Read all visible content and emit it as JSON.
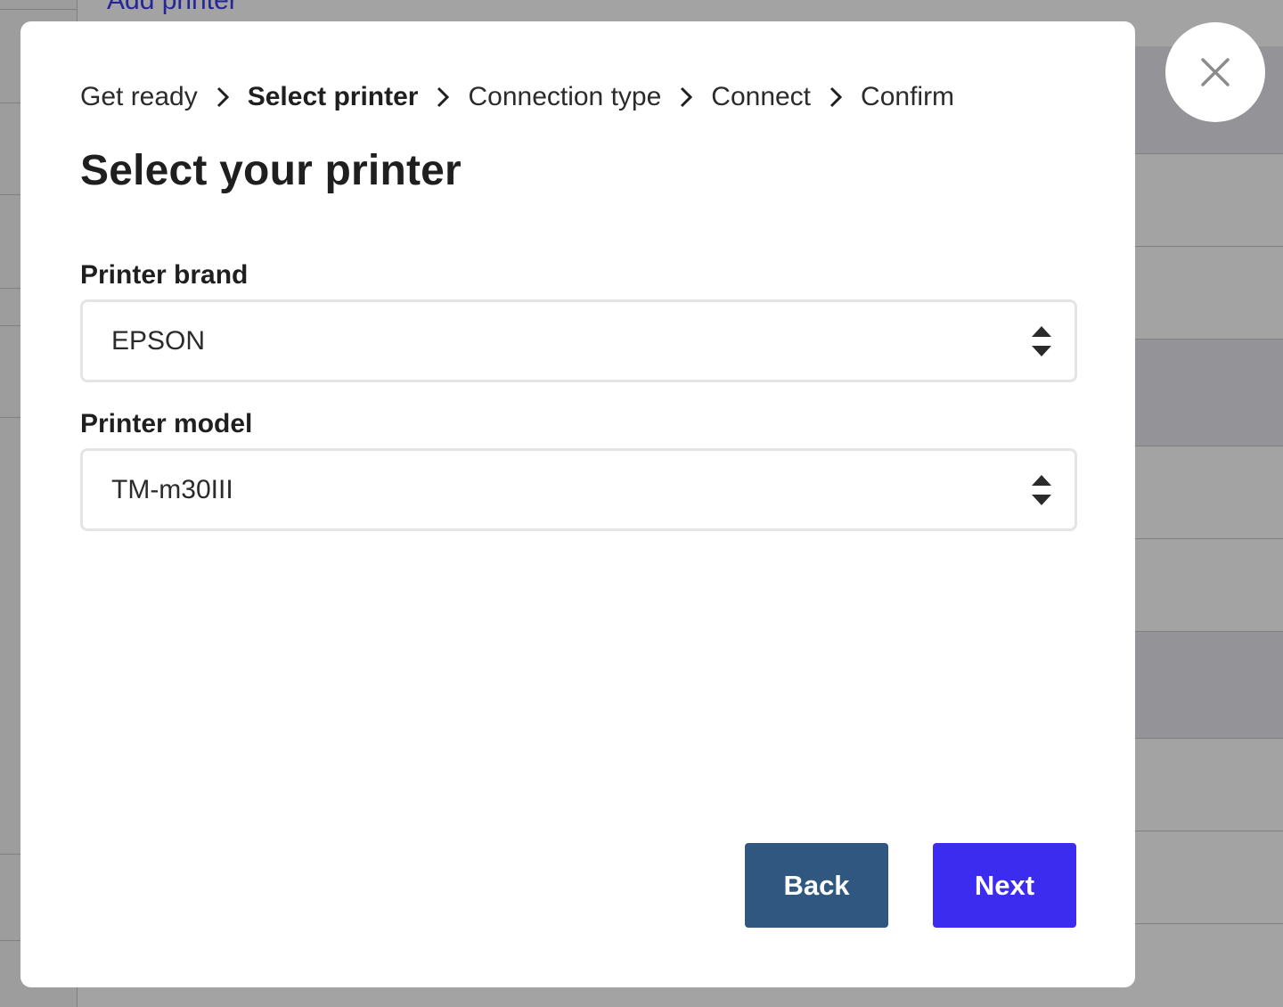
{
  "background": {
    "add_printer_link": "Add printer"
  },
  "modal": {
    "breadcrumb": [
      {
        "label": "Get ready"
      },
      {
        "label": "Select printer"
      },
      {
        "label": "Connection type"
      },
      {
        "label": "Connect"
      },
      {
        "label": "Confirm"
      }
    ],
    "active_step": "Select printer",
    "title": "Select your printer",
    "brand_field": {
      "label": "Printer brand",
      "value": "EPSON"
    },
    "model_field": {
      "label": "Printer model",
      "value": "TM-m30III"
    },
    "back_label": "Back",
    "next_label": "Next",
    "close_icon": "close-icon"
  },
  "colors": {
    "back_button": "#2f577f",
    "next_button": "#3b2cf0",
    "link": "#3b3bf0"
  }
}
